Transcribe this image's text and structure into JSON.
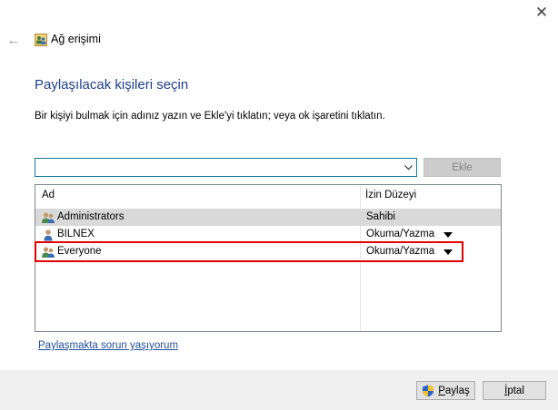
{
  "window": {
    "close_glyph": "✕",
    "back_glyph": "←",
    "title": "Ağ erişimi"
  },
  "heading": "Paylaşılacak kişileri seçin",
  "instruction": "Bir kişiyi bulmak için adınız yazın ve Ekle'yi tıklatın; veya ok işaretini tıklatın.",
  "input": {
    "value": "",
    "placeholder": ""
  },
  "add_button": "Ekle",
  "list": {
    "columns": {
      "name": "Ad",
      "permission": "İzin Düzeyi"
    },
    "rows": [
      {
        "name": "Administrators",
        "permission": "Sahibi",
        "icon": "user-group-icon",
        "selected": true,
        "has_dropdown": false
      },
      {
        "name": "BILNEX",
        "permission": "Okuma/Yazma",
        "icon": "user-icon",
        "selected": false,
        "has_dropdown": true
      },
      {
        "name": "Everyone",
        "permission": "Okuma/Yazma",
        "icon": "user-group-icon",
        "selected": false,
        "has_dropdown": true,
        "highlighted": true
      }
    ]
  },
  "help_link": "Paylaşmakta sorun yaşıyorum",
  "footer": {
    "share_button": {
      "mnemonic": "P",
      "rest": "aylaş"
    },
    "cancel_button": {
      "mnemonic": "İ",
      "rest": "ptal"
    }
  },
  "colors": {
    "heading": "#1e3f8a",
    "link": "#1f4e9c",
    "highlight_box": "#e00000",
    "selected_row": "#d9d9d9",
    "input_border": "#0e7a97"
  }
}
